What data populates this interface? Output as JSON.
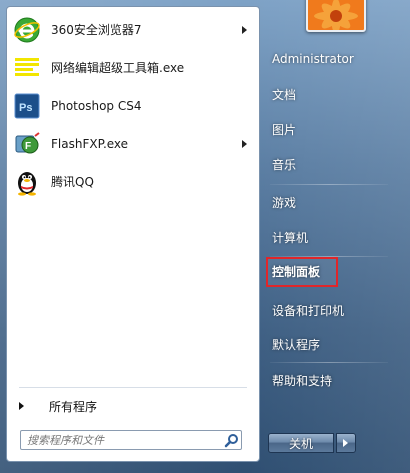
{
  "programs": [
    {
      "label": "360安全浏览器7",
      "icon": "360-browser-icon",
      "submenu": true
    },
    {
      "label": "网络编辑超级工具箱.exe",
      "icon": "toolbox-app-icon",
      "submenu": false
    },
    {
      "label": "Photoshop CS4",
      "icon": "photoshop-icon",
      "submenu": false
    },
    {
      "label": "FlashFXP.exe",
      "icon": "flashfxp-icon",
      "submenu": true
    },
    {
      "label": "腾讯QQ",
      "icon": "qq-penguin-icon",
      "submenu": false
    }
  ],
  "all_programs": "所有程序",
  "search": {
    "placeholder": "搜索程序和文件"
  },
  "right_menu": {
    "user": "Administrator",
    "documents": "文档",
    "pictures": "图片",
    "music": "音乐",
    "games": "游戏",
    "computer": "计算机",
    "control_panel": "控制面板",
    "devices": "设备和打印机",
    "default_programs": "默认程序",
    "help": "帮助和支持"
  },
  "shutdown": {
    "label": "关机"
  },
  "colors": {
    "highlight_border": "#e0262a",
    "ps_blue": "#1c4f8a",
    "toolbox_yellow": "#f2e600"
  }
}
